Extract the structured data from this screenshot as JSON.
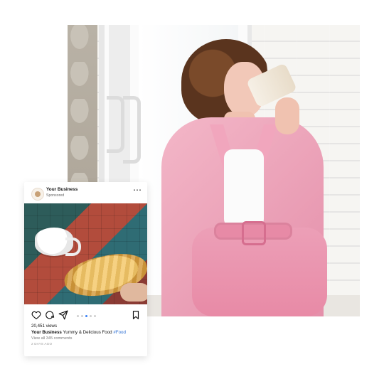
{
  "ig_card": {
    "account_name": "Your Business",
    "sponsored_label": "Sponsored",
    "more_icon": "more-icon",
    "views_text": "20,451 views",
    "caption_username": "Your Business",
    "caption_text": "Yummy & Delicious Food",
    "hashtag": "#Food",
    "view_comments": "View all 345 comments",
    "timestamp": "2 DAYS AGO",
    "carousel_dots_total": 5,
    "carousel_dots_active_index": 2
  },
  "colors": {
    "link_blue": "#2d6fd3",
    "card_background": "#ffffff",
    "pink_suit": "#e48ea9"
  },
  "icons": {
    "like": "heart-icon",
    "comment": "comment-icon",
    "share": "share-icon",
    "save": "bookmark-icon",
    "avatar": "avatar-icon"
  }
}
